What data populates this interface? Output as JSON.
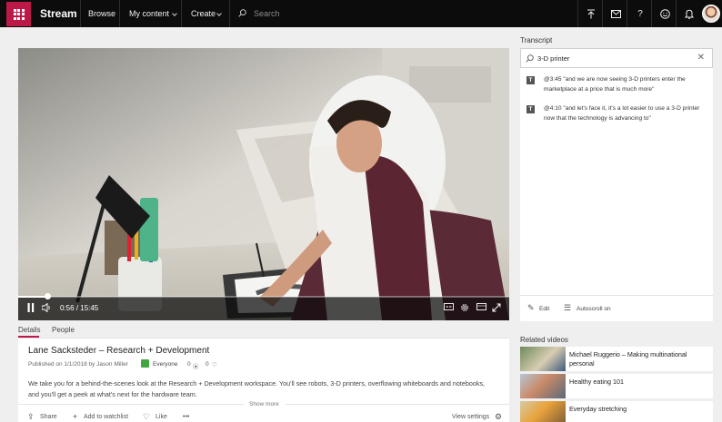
{
  "topbar": {
    "brand": "Stream",
    "nav": [
      "Browse",
      "My content",
      "Create"
    ],
    "search_placeholder": "Search",
    "icons": [
      "upload-icon",
      "mail-icon",
      "help-icon",
      "smiley-icon",
      "notification-bell-icon"
    ]
  },
  "player": {
    "time": "0:56 / 15:45",
    "progress_fraction": 0.06
  },
  "tabs": [
    "Details",
    "People"
  ],
  "video": {
    "title": "Lane Sacksteder – Research + Development",
    "published": "Published on 1/1/2018 by Jason Miller",
    "audience": "Everyone",
    "views": "0",
    "likes": "0",
    "description": "We take you for a behind-the-scenes look at the Research + Development workspace. You'll see robots, 3-D printers, overflowing whiteboards and notebooks, and you'll get a peek at what's next for the hardware team.",
    "show_more": "Show more"
  },
  "actions": {
    "share": "Share",
    "watchlist": "Add to watchlist",
    "like": "Like",
    "more": "•••",
    "view_settings": "View settings"
  },
  "transcript": {
    "heading": "Transcript",
    "search_value": "3-D printer",
    "entries": [
      {
        "badge": "T",
        "text": "@3:45 \"and we are now seeing 3-D printers enter the marketplace at a price that is much more\""
      },
      {
        "badge": "T",
        "text": "@4:10 \"and let's face it, it's a lot easier to use a 3-D printer now that the technology is advancing to\""
      }
    ],
    "edit": "Edit",
    "autoscroll": "Autoscroll on"
  },
  "related": {
    "heading": "Related videos",
    "items": [
      {
        "title": "Michael Ruggerio – Making multinational personal"
      },
      {
        "title": "Healthy eating 101"
      },
      {
        "title": "Everyday stretching"
      }
    ]
  },
  "colors": {
    "brand": "#bc1948",
    "topbar": "#0c0c0c",
    "audience_badge": "#41a541"
  }
}
